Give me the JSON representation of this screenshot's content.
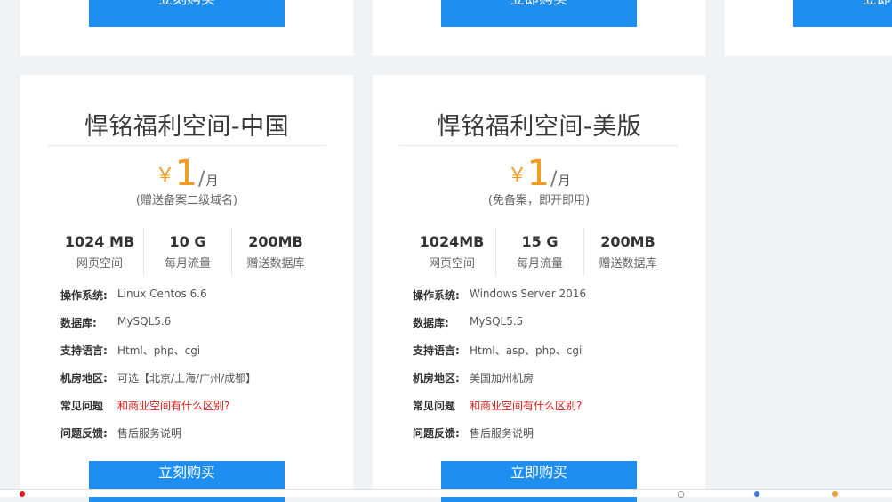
{
  "top_row": {
    "buttons": [
      "立刻购买",
      "立即购买",
      "立即"
    ]
  },
  "plans": [
    {
      "title": "悍铭福利空间-中国",
      "currency": "￥",
      "price": "1",
      "slash": "/",
      "unit": "月",
      "note": "(赠送备案二级域名)",
      "stats": [
        {
          "value": "1024 MB",
          "label": "网页空间"
        },
        {
          "value": "10 G",
          "label": "每月流量"
        },
        {
          "value": "200MB",
          "label": "赠送数据库"
        }
      ],
      "specs": [
        {
          "key": "操作系统:",
          "value": "Linux Centos 6.6"
        },
        {
          "key": "数据库:",
          "value": "MySQL5.6"
        },
        {
          "key": "支持语言:",
          "value": "Html、php、cgi"
        },
        {
          "key": "机房地区:",
          "value": "可选【北京/上海/广州/成都】"
        },
        {
          "key": "常见问题",
          "value": "和商业空间有什么区别?"
        },
        {
          "key": "问题反馈:",
          "value": "售后服务说明"
        }
      ],
      "button": "立刻购买"
    },
    {
      "title": "悍铭福利空间-美版",
      "currency": "￥",
      "price": "1",
      "slash": "/",
      "unit": "月",
      "note": "(免备案，即开即用)",
      "stats": [
        {
          "value": "1024MB",
          "label": "网页空间"
        },
        {
          "value": "15 G",
          "label": "每月流量"
        },
        {
          "value": "200MB",
          "label": "赠送数据库"
        }
      ],
      "specs": [
        {
          "key": "操作系统:",
          "value": "Windows Server 2016"
        },
        {
          "key": "数据库:",
          "value": "MySQL5.5"
        },
        {
          "key": "支持语言:",
          "value": "Html、asp、php、cgi"
        },
        {
          "key": "机房地区:",
          "value": "美国加州机房"
        },
        {
          "key": "常见问题",
          "value": "和商业空间有什么区别?"
        },
        {
          "key": "问题反馈:",
          "value": "售后服务说明"
        }
      ],
      "button": "立即购买"
    }
  ],
  "colors": {
    "accent": "#1f8ef1",
    "price": "#f29b1e",
    "link_red": "#e01a1a",
    "background": "#f0f3f5"
  }
}
